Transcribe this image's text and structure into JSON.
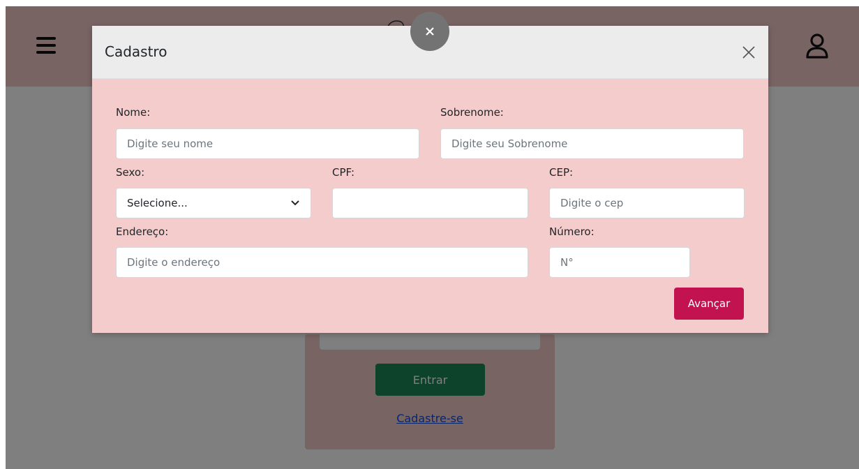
{
  "background": {
    "login": {
      "submit_label": "Entrar",
      "signup_link": "Cadastre-se"
    }
  },
  "modal": {
    "title": "Cadastro",
    "fields": {
      "nome": {
        "label": "Nome:",
        "placeholder": "Digite seu nome"
      },
      "sobrenome": {
        "label": "Sobrenome:",
        "placeholder": "Digite seu Sobrenome"
      },
      "sexo": {
        "label": "Sexo:",
        "selected": "Selecione..."
      },
      "cpf": {
        "label": "CPF:",
        "placeholder": ""
      },
      "cep": {
        "label": "CEP:",
        "placeholder": "Digite o cep"
      },
      "endereco": {
        "label": "Endereço:",
        "placeholder": "Digite o endereço"
      },
      "numero": {
        "label": "Número:",
        "placeholder": "N°"
      }
    },
    "submit_label": "Avançar"
  },
  "colors": {
    "brand_pink": "#f3c9c9",
    "accent": "#c2124f",
    "success": "#198754",
    "link": "#0d4bd8"
  },
  "icons": [
    "hamburger-menu-icon",
    "user-icon",
    "close-icon",
    "chevron-down-icon"
  ]
}
